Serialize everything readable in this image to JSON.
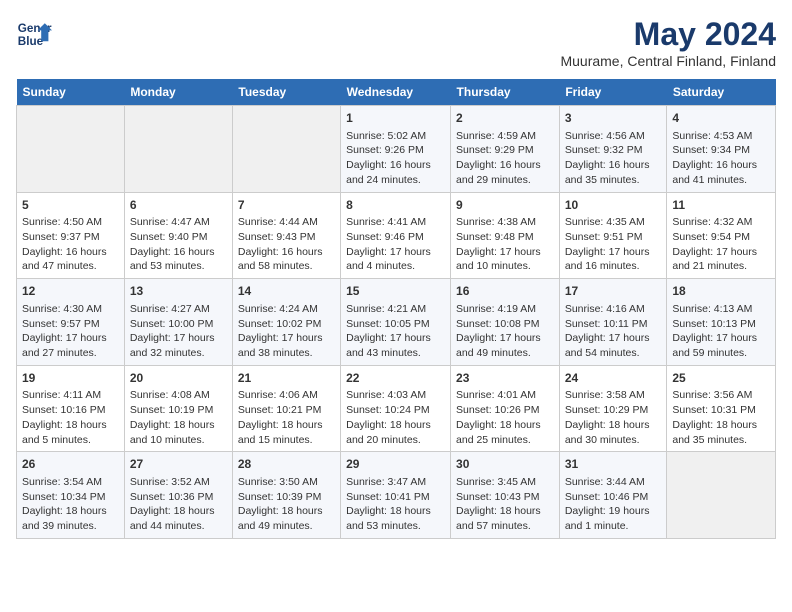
{
  "header": {
    "logo_line1": "General",
    "logo_line2": "Blue",
    "month": "May 2024",
    "location": "Muurame, Central Finland, Finland"
  },
  "weekdays": [
    "Sunday",
    "Monday",
    "Tuesday",
    "Wednesday",
    "Thursday",
    "Friday",
    "Saturday"
  ],
  "weeks": [
    [
      {
        "day": "",
        "empty": true
      },
      {
        "day": "",
        "empty": true
      },
      {
        "day": "",
        "empty": true
      },
      {
        "day": "1",
        "sunrise": "5:02 AM",
        "sunset": "9:26 PM",
        "daylight": "16 hours and 24 minutes."
      },
      {
        "day": "2",
        "sunrise": "4:59 AM",
        "sunset": "9:29 PM",
        "daylight": "16 hours and 29 minutes."
      },
      {
        "day": "3",
        "sunrise": "4:56 AM",
        "sunset": "9:32 PM",
        "daylight": "16 hours and 35 minutes."
      },
      {
        "day": "4",
        "sunrise": "4:53 AM",
        "sunset": "9:34 PM",
        "daylight": "16 hours and 41 minutes."
      }
    ],
    [
      {
        "day": "5",
        "sunrise": "4:50 AM",
        "sunset": "9:37 PM",
        "daylight": "16 hours and 47 minutes."
      },
      {
        "day": "6",
        "sunrise": "4:47 AM",
        "sunset": "9:40 PM",
        "daylight": "16 hours and 53 minutes."
      },
      {
        "day": "7",
        "sunrise": "4:44 AM",
        "sunset": "9:43 PM",
        "daylight": "16 hours and 58 minutes."
      },
      {
        "day": "8",
        "sunrise": "4:41 AM",
        "sunset": "9:46 PM",
        "daylight": "17 hours and 4 minutes."
      },
      {
        "day": "9",
        "sunrise": "4:38 AM",
        "sunset": "9:48 PM",
        "daylight": "17 hours and 10 minutes."
      },
      {
        "day": "10",
        "sunrise": "4:35 AM",
        "sunset": "9:51 PM",
        "daylight": "17 hours and 16 minutes."
      },
      {
        "day": "11",
        "sunrise": "4:32 AM",
        "sunset": "9:54 PM",
        "daylight": "17 hours and 21 minutes."
      }
    ],
    [
      {
        "day": "12",
        "sunrise": "4:30 AM",
        "sunset": "9:57 PM",
        "daylight": "17 hours and 27 minutes."
      },
      {
        "day": "13",
        "sunrise": "4:27 AM",
        "sunset": "10:00 PM",
        "daylight": "17 hours and 32 minutes."
      },
      {
        "day": "14",
        "sunrise": "4:24 AM",
        "sunset": "10:02 PM",
        "daylight": "17 hours and 38 minutes."
      },
      {
        "day": "15",
        "sunrise": "4:21 AM",
        "sunset": "10:05 PM",
        "daylight": "17 hours and 43 minutes."
      },
      {
        "day": "16",
        "sunrise": "4:19 AM",
        "sunset": "10:08 PM",
        "daylight": "17 hours and 49 minutes."
      },
      {
        "day": "17",
        "sunrise": "4:16 AM",
        "sunset": "10:11 PM",
        "daylight": "17 hours and 54 minutes."
      },
      {
        "day": "18",
        "sunrise": "4:13 AM",
        "sunset": "10:13 PM",
        "daylight": "17 hours and 59 minutes."
      }
    ],
    [
      {
        "day": "19",
        "sunrise": "4:11 AM",
        "sunset": "10:16 PM",
        "daylight": "18 hours and 5 minutes."
      },
      {
        "day": "20",
        "sunrise": "4:08 AM",
        "sunset": "10:19 PM",
        "daylight": "18 hours and 10 minutes."
      },
      {
        "day": "21",
        "sunrise": "4:06 AM",
        "sunset": "10:21 PM",
        "daylight": "18 hours and 15 minutes."
      },
      {
        "day": "22",
        "sunrise": "4:03 AM",
        "sunset": "10:24 PM",
        "daylight": "18 hours and 20 minutes."
      },
      {
        "day": "23",
        "sunrise": "4:01 AM",
        "sunset": "10:26 PM",
        "daylight": "18 hours and 25 minutes."
      },
      {
        "day": "24",
        "sunrise": "3:58 AM",
        "sunset": "10:29 PM",
        "daylight": "18 hours and 30 minutes."
      },
      {
        "day": "25",
        "sunrise": "3:56 AM",
        "sunset": "10:31 PM",
        "daylight": "18 hours and 35 minutes."
      }
    ],
    [
      {
        "day": "26",
        "sunrise": "3:54 AM",
        "sunset": "10:34 PM",
        "daylight": "18 hours and 39 minutes."
      },
      {
        "day": "27",
        "sunrise": "3:52 AM",
        "sunset": "10:36 PM",
        "daylight": "18 hours and 44 minutes."
      },
      {
        "day": "28",
        "sunrise": "3:50 AM",
        "sunset": "10:39 PM",
        "daylight": "18 hours and 49 minutes."
      },
      {
        "day": "29",
        "sunrise": "3:47 AM",
        "sunset": "10:41 PM",
        "daylight": "18 hours and 53 minutes."
      },
      {
        "day": "30",
        "sunrise": "3:45 AM",
        "sunset": "10:43 PM",
        "daylight": "18 hours and 57 minutes."
      },
      {
        "day": "31",
        "sunrise": "3:44 AM",
        "sunset": "10:46 PM",
        "daylight": "19 hours and 1 minute."
      },
      {
        "day": "",
        "empty": true
      }
    ]
  ]
}
